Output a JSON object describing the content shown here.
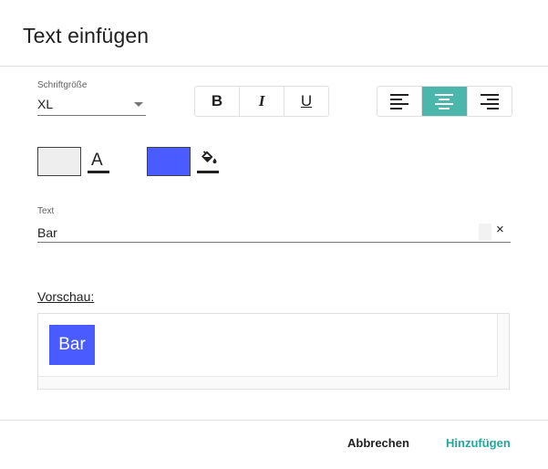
{
  "dialog": {
    "title": "Text einfügen"
  },
  "font_size": {
    "label": "Schriftgröße",
    "value": "XL"
  },
  "format_buttons": {
    "bold": "B",
    "italic": "I",
    "underline": "U"
  },
  "align_buttons": {
    "selected": "center",
    "icons": [
      "align-left-icon",
      "align-center-icon",
      "align-right-icon"
    ]
  },
  "colors": {
    "text_color": "#eeeeee",
    "text_icon": "A",
    "background_color": "#4a5cff",
    "accent": "#4db6ac",
    "primary_action": "#26a69a"
  },
  "text_field": {
    "label": "Text",
    "value": "Bar",
    "clear": "×"
  },
  "preview": {
    "label": "Vorschau:",
    "content": "Bar"
  },
  "footer": {
    "cancel": "Abbrechen",
    "add": "Hinzufügen"
  }
}
